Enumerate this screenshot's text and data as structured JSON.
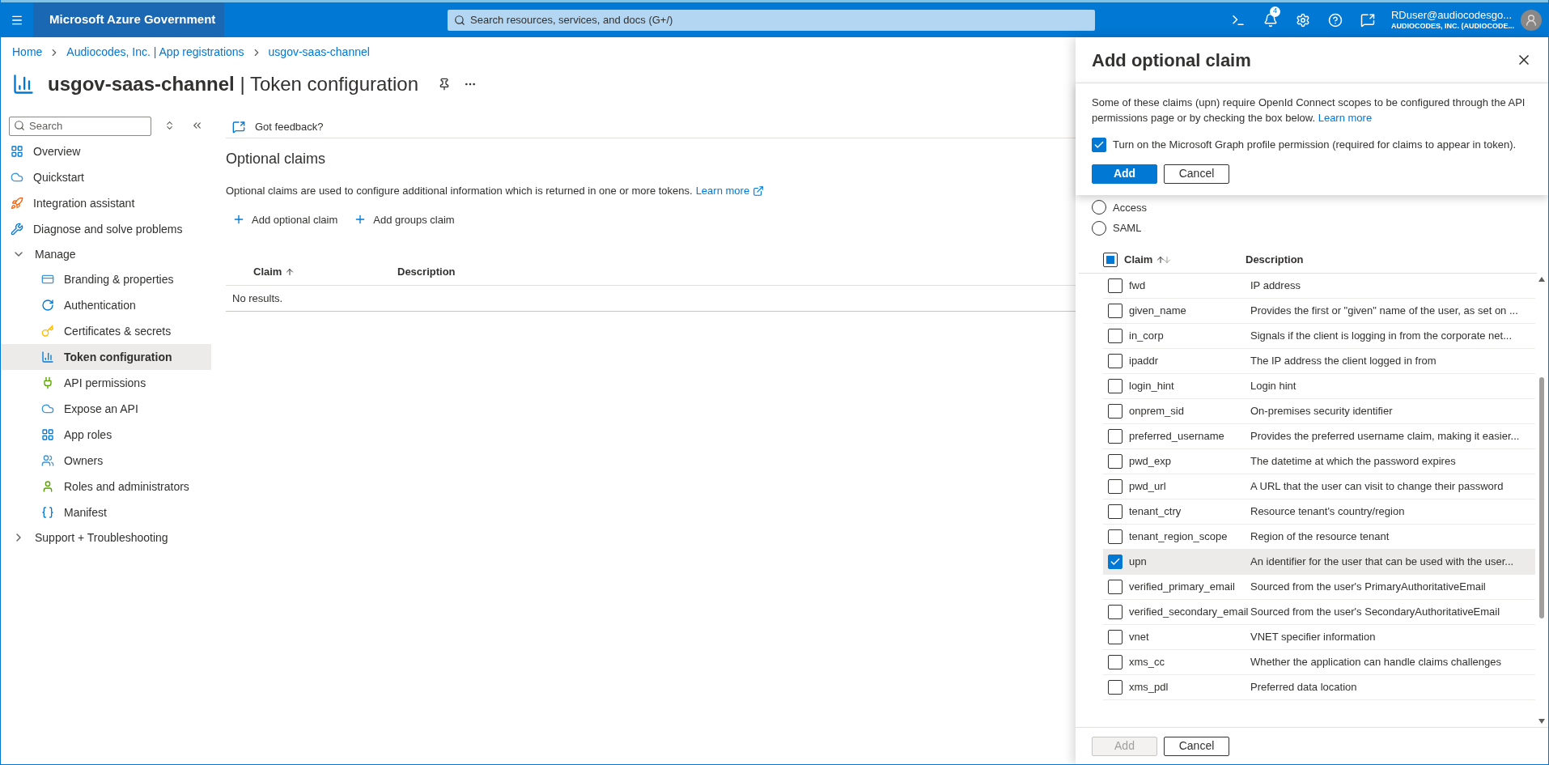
{
  "topbar": {
    "brand": "Microsoft Azure Government",
    "search_placeholder": "Search resources, services, and docs (G+/)",
    "notification_count": "4",
    "user_name": "RDuser@audiocodesgo...",
    "user_org": "AUDIOCODES, INC. (AUDIOCODE..."
  },
  "breadcrumb": [
    "Home",
    "Audiocodes, Inc. | App registrations",
    "usgov-saas-channel"
  ],
  "page": {
    "title": "**usgov-saas-channel** | Token configuration"
  },
  "sidebar": {
    "search_placeholder": "Search",
    "items": [
      {
        "label": "Overview",
        "kind": "item",
        "selected": false
      },
      {
        "label": "Quickstart",
        "kind": "item",
        "selected": false
      },
      {
        "label": "Integration assistant",
        "kind": "item",
        "selected": false
      },
      {
        "label": "Diagnose and solve problems",
        "kind": "item",
        "selected": false
      },
      {
        "label": "Manage",
        "kind": "group",
        "expanded": true,
        "children": [
          {
            "label": "Branding & properties",
            "selected": false
          },
          {
            "label": "Authentication",
            "selected": false
          },
          {
            "label": "Certificates & secrets",
            "selected": false
          },
          {
            "label": "Token configuration",
            "selected": true
          },
          {
            "label": "API permissions",
            "selected": false
          },
          {
            "label": "Expose an API",
            "selected": false
          },
          {
            "label": "App roles",
            "selected": false
          },
          {
            "label": "Owners",
            "selected": false
          },
          {
            "label": "Roles and administrators",
            "selected": false
          },
          {
            "label": "Manifest",
            "selected": false
          }
        ]
      },
      {
        "label": "Support + Troubleshooting",
        "kind": "group",
        "expanded": false
      }
    ]
  },
  "toolbar": {
    "feedback": "Got feedback?"
  },
  "section": {
    "title": "Optional claims",
    "description": "Optional claims are used to configure additional information which is returned in one or more tokens.",
    "learn_more": "Learn more",
    "actions": [
      "Add optional claim",
      "Add groups claim"
    ],
    "table": {
      "columns": [
        "Claim",
        "Description"
      ],
      "empty": "No results."
    }
  },
  "panel": {
    "title": "Add optional claim",
    "notice": {
      "text": "Some of these claims (upn) require OpenId Connect scopes to be configured through the API permissions page or by checking the box below.",
      "learn_more": "Learn more",
      "checkbox": {
        "label": "Turn on the Microsoft Graph profile permission (required for claims to appear in token).",
        "checked": true
      },
      "buttons": [
        {
          "label": "Add",
          "kind": "primary",
          "disabled": false
        },
        {
          "label": "Cancel",
          "kind": "secondary",
          "disabled": false
        }
      ]
    },
    "token_types": [
      {
        "label": "Access",
        "selected": false
      },
      {
        "label": "SAML",
        "selected": false
      }
    ],
    "table": {
      "columns": [
        "Claim",
        "Description"
      ],
      "select_all": {
        "checked": false,
        "indeterminate": true
      },
      "rows": [
        {
          "claim": "fwd",
          "description": "IP address",
          "checked": false
        },
        {
          "claim": "given_name",
          "description": "Provides the first or \"given\" name of the user, as set on ...",
          "checked": false
        },
        {
          "claim": "in_corp",
          "description": "Signals if the client is logging in from the corporate net...",
          "checked": false
        },
        {
          "claim": "ipaddr",
          "description": "The IP address the client logged in from",
          "checked": false
        },
        {
          "claim": "login_hint",
          "description": "Login hint",
          "checked": false
        },
        {
          "claim": "onprem_sid",
          "description": "On-premises security identifier",
          "checked": false
        },
        {
          "claim": "preferred_username",
          "description": "Provides the preferred username claim, making it easier...",
          "checked": false
        },
        {
          "claim": "pwd_exp",
          "description": "The datetime at which the password expires",
          "checked": false
        },
        {
          "claim": "pwd_url",
          "description": "A URL that the user can visit to change their password",
          "checked": false
        },
        {
          "claim": "tenant_ctry",
          "description": "Resource tenant's country/region",
          "checked": false
        },
        {
          "claim": "tenant_region_scope",
          "description": "Region of the resource tenant",
          "checked": false
        },
        {
          "claim": "upn",
          "description": "An identifier for the user that can be used with the user...",
          "checked": true
        },
        {
          "claim": "verified_primary_email",
          "description": "Sourced from the user's PrimaryAuthoritativeEmail",
          "checked": false
        },
        {
          "claim": "verified_secondary_email",
          "description": "Sourced from the user's SecondaryAuthoritativeEmail",
          "checked": false
        },
        {
          "claim": "vnet",
          "description": "VNET specifier information",
          "checked": false
        },
        {
          "claim": "xms_cc",
          "description": "Whether the application can handle claims challenges",
          "checked": false
        },
        {
          "claim": "xms_pdl",
          "description": "Preferred data location",
          "checked": false
        }
      ]
    },
    "footer": [
      {
        "label": "Add",
        "kind": "primary",
        "disabled": true
      },
      {
        "label": "Cancel",
        "kind": "secondary",
        "disabled": false
      }
    ]
  }
}
